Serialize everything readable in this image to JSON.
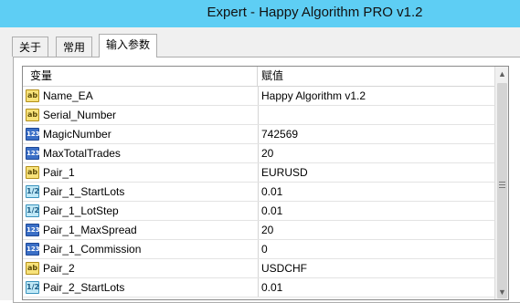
{
  "window": {
    "title": "Expert - Happy Algorithm PRO v1.2"
  },
  "tabs": [
    {
      "label": "关于"
    },
    {
      "label": "常用"
    },
    {
      "label": "输入参数"
    }
  ],
  "table": {
    "columns": [
      "变量",
      "赋值"
    ],
    "rows": [
      {
        "type": "ab",
        "icon": "string-type-icon",
        "name": "Name_EA",
        "value": "Happy Algorithm v1.2"
      },
      {
        "type": "ab",
        "icon": "string-type-icon",
        "name": "Serial_Number",
        "value": ""
      },
      {
        "type": "123",
        "icon": "integer-type-icon",
        "name": "MagicNumber",
        "value": "742569"
      },
      {
        "type": "123",
        "icon": "integer-type-icon",
        "name": "MaxTotalTrades",
        "value": "20"
      },
      {
        "type": "ab",
        "icon": "string-type-icon",
        "name": "Pair_1",
        "value": "EURUSD"
      },
      {
        "type": "1/2",
        "icon": "double-type-icon",
        "name": "Pair_1_StartLots",
        "value": "0.01"
      },
      {
        "type": "1/2",
        "icon": "double-type-icon",
        "name": "Pair_1_LotStep",
        "value": "0.01"
      },
      {
        "type": "123",
        "icon": "integer-type-icon",
        "name": "Pair_1_MaxSpread",
        "value": "20"
      },
      {
        "type": "123",
        "icon": "integer-type-icon",
        "name": "Pair_1_Commission",
        "value": "0"
      },
      {
        "type": "ab",
        "icon": "string-type-icon",
        "name": "Pair_2",
        "value": "USDCHF"
      },
      {
        "type": "1/2",
        "icon": "double-type-icon",
        "name": "Pair_2_StartLots",
        "value": "0.01"
      }
    ]
  },
  "scrollbar": {
    "up_icon": "scroll-up-arrow-icon",
    "down_icon": "scroll-down-arrow-icon"
  }
}
